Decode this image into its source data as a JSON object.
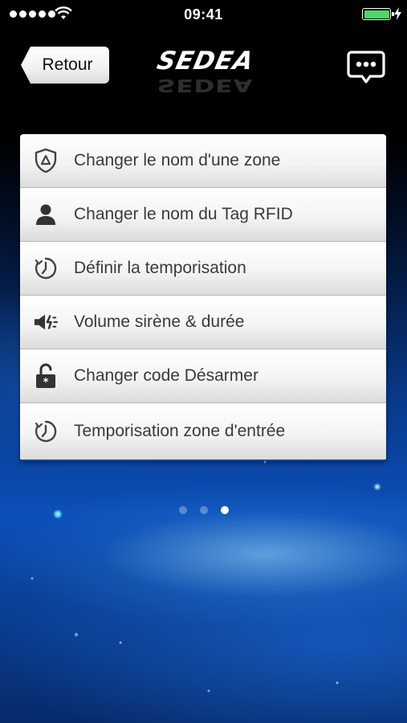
{
  "status_bar": {
    "time": "09:41",
    "battery_color": "#4cd964"
  },
  "nav": {
    "back_label": "Retour",
    "logo_text": "SEDEA"
  },
  "menu": {
    "items": [
      {
        "label": "Changer le nom d'une zone",
        "icon": "shield-icon"
      },
      {
        "label": "Changer le nom du Tag RFID",
        "icon": "user-icon"
      },
      {
        "label": "Définir la temporisation",
        "icon": "timer-icon"
      },
      {
        "label": "Volume  sirène & durée",
        "icon": "speaker-icon"
      },
      {
        "label": "Changer code Désarmer",
        "icon": "unlock-icon"
      },
      {
        "label": "Temporisation zone d'entrée",
        "icon": "timer-icon"
      }
    ]
  },
  "pager": {
    "page_count": 3,
    "active_page": 3
  }
}
